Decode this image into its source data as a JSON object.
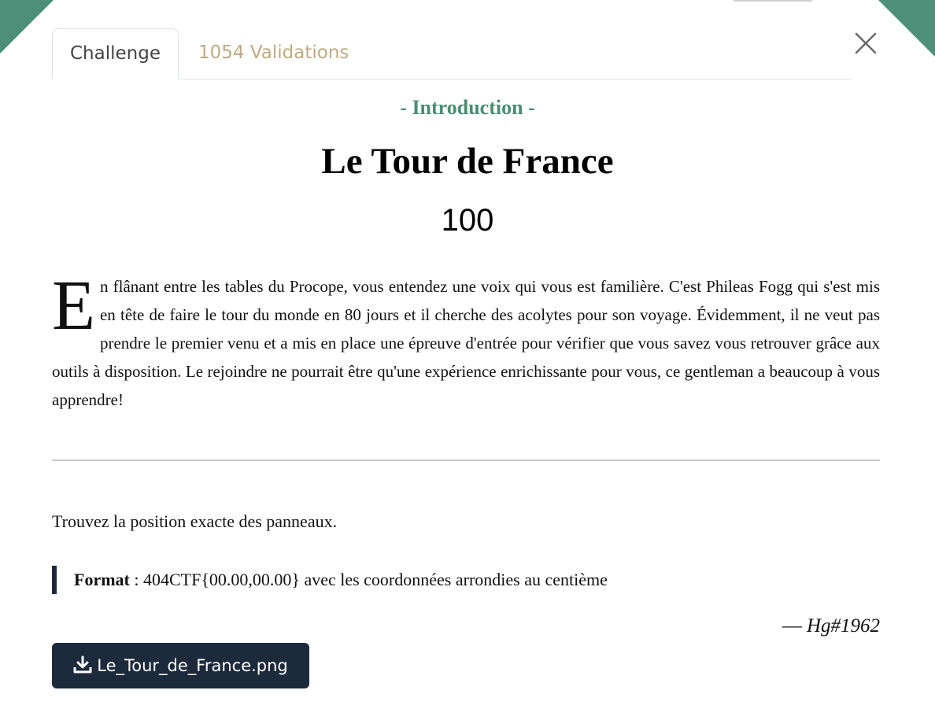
{
  "tabs": {
    "challenge": "Challenge",
    "validations": "1054 Validations"
  },
  "challenge": {
    "category": "- Introduction -",
    "title": "Le Tour de France",
    "points": "100",
    "intro_dropcap": "E",
    "intro_rest": "n flânant entre les tables du Procope, vous entendez une voix qui vous est familière. C'est Phileas Fogg qui s'est mis en tête de faire le tour du monde en 80 jours et il cherche des acolytes pour son voyage. Évidemment, il ne veut pas prendre le premier venu et a mis en place une épreuve d'entrée pour vérifier que vous savez vous retrouver grâce aux outils à disposition. Le rejoindre ne pourrait être qu'une expérience enrichissante pour vous, ce gentleman a beaucoup à vous apprendre!",
    "instruction": "Trouvez la position exacte des panneaux.",
    "format_label": "Format",
    "format_text": " : 404CTF{00.00,00.00} avec les coordonnées arrondies au centième",
    "author_dash": "— ",
    "author": "Hg#1962",
    "file_name": "Le_Tour_de_France.png"
  },
  "icons": {
    "close": "close-icon",
    "download": "download-icon"
  },
  "colors": {
    "accent_green": "#4d8f78",
    "validations_tab": "#c0a982",
    "button_bg": "#1c2a3c"
  }
}
